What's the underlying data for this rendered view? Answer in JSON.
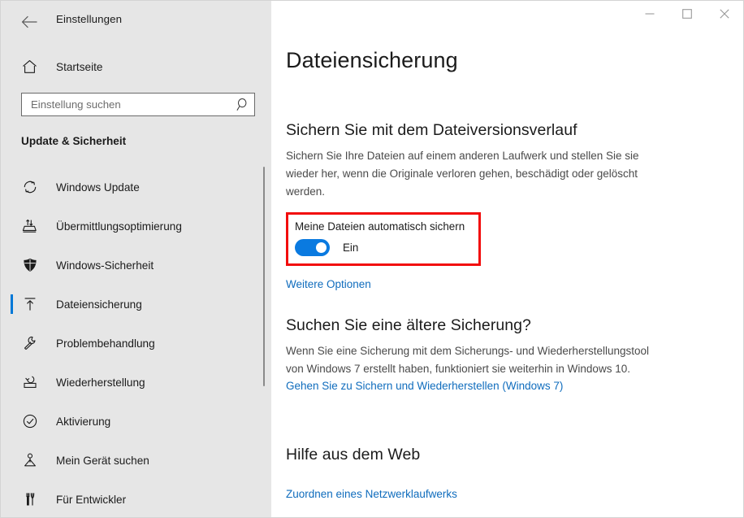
{
  "window": {
    "app_title": "Einstellungen",
    "back_icon": "back-arrow-icon",
    "controls": {
      "minimize": "minimize-icon",
      "maximize": "maximize-icon",
      "close": "close-icon"
    }
  },
  "sidebar": {
    "home_label": "Startseite",
    "home_icon": "home-icon",
    "search": {
      "placeholder": "Einstellung suchen",
      "value": "",
      "icon": "search-icon"
    },
    "group_title": "Update & Sicherheit",
    "selected_index": 3,
    "accent_color": "#0078d7",
    "items": [
      {
        "label": "Windows Update",
        "icon": "sync-icon"
      },
      {
        "label": "Übermittlungsoptimierung",
        "icon": "delivery-optimization-icon"
      },
      {
        "label": "Windows-Sicherheit",
        "icon": "shield-icon"
      },
      {
        "label": "Dateiensicherung",
        "icon": "backup-upload-icon"
      },
      {
        "label": "Problembehandlung",
        "icon": "wrench-icon"
      },
      {
        "label": "Wiederherstellung",
        "icon": "recovery-icon"
      },
      {
        "label": "Aktivierung",
        "icon": "check-circle-icon"
      },
      {
        "label": "Mein Gerät suchen",
        "icon": "find-my-device-icon"
      },
      {
        "label": "Für Entwickler",
        "icon": "developer-tools-icon"
      }
    ]
  },
  "main": {
    "page_title": "Dateiensicherung",
    "file_history": {
      "heading": "Sichern Sie mit dem Dateiversionsverlauf",
      "paragraph": "Sichern Sie Ihre Dateien auf einem anderen Laufwerk und stellen Sie sie wieder her, wenn die Originale verloren gehen, beschädigt oder gelöscht werden.",
      "toggle_caption": "Meine Dateien automatisch sichern",
      "toggle_state_label": "Ein",
      "toggle_on": true,
      "more_options_link": "Weitere Optionen",
      "highlight_color": "#f20d0d"
    },
    "older_backup": {
      "heading": "Suchen Sie eine ältere Sicherung?",
      "paragraph": "Wenn Sie eine Sicherung mit dem Sicherungs- und Wiederherstellungstool von Windows 7 erstellt haben, funktioniert sie weiterhin in Windows 10.",
      "link": "Gehen Sie zu Sichern und Wiederherstellen (Windows 7)"
    },
    "web_help": {
      "heading": "Hilfe aus dem Web",
      "link": "Zuordnen eines Netzwerklaufwerks"
    },
    "link_color": "#0f6cbd"
  }
}
